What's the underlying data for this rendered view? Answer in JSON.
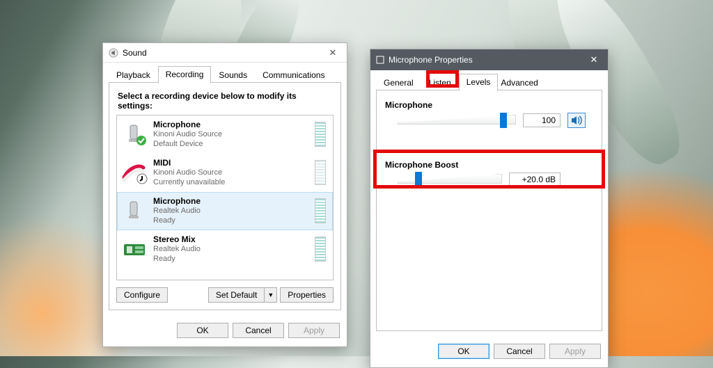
{
  "sound_dialog": {
    "title": "Sound",
    "tabs": [
      "Playback",
      "Recording",
      "Sounds",
      "Communications"
    ],
    "active_tab": 1,
    "instruction": "Select a recording device below to modify its settings:",
    "devices": [
      {
        "name": "Microphone",
        "source": "Kinoni Audio Source",
        "status": "Default Device",
        "badge": "check"
      },
      {
        "name": "MIDI",
        "source": "Kinoni Audio Source",
        "status": "Currently unavailable",
        "badge": "down"
      },
      {
        "name": "Microphone",
        "source": "Realtek Audio",
        "status": "Ready",
        "selected": true
      },
      {
        "name": "Stereo Mix",
        "source": "Realtek Audio",
        "status": "Ready"
      }
    ],
    "buttons": {
      "configure": "Configure",
      "set_default": "Set Default",
      "properties": "Properties",
      "ok": "OK",
      "cancel": "Cancel",
      "apply": "Apply"
    }
  },
  "mic_props": {
    "title": "Microphone Properties",
    "tabs": [
      "General",
      "Listen",
      "Levels",
      "Advanced"
    ],
    "active_tab": 2,
    "sections": {
      "mic": {
        "label": "Microphone",
        "value": "100",
        "slider_pct": 92
      },
      "boost": {
        "label": "Microphone Boost",
        "value": "+20.0 dB",
        "slider_pct": 18
      }
    },
    "buttons": {
      "ok": "OK",
      "cancel": "Cancel",
      "apply": "Apply"
    }
  },
  "highlights": {
    "levels_tab": true,
    "boost_section": true
  }
}
